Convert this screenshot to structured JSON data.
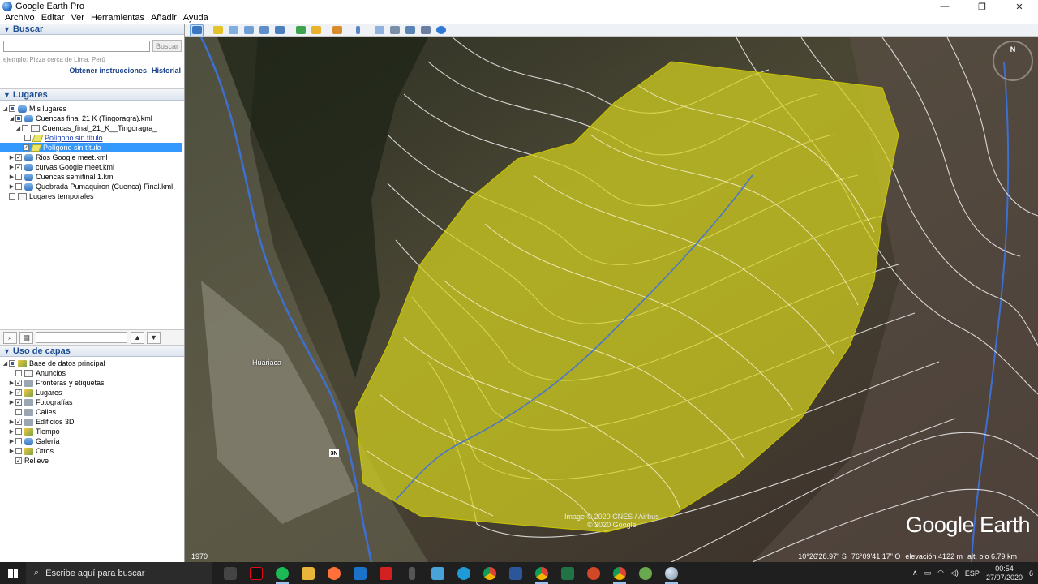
{
  "window": {
    "title": "Google Earth Pro",
    "controls": [
      "—",
      "❐",
      "✕"
    ]
  },
  "menu": [
    "Archivo",
    "Editar",
    "Ver",
    "Herramientas",
    "Añadir",
    "Ayuda"
  ],
  "search": {
    "header": "Buscar",
    "button": "Buscar",
    "hint": "ejemplo: Pizza cerca de Lima, Perú",
    "link_directions": "Obtener instrucciones",
    "link_history": "Historial"
  },
  "places": {
    "header": "Lugares",
    "items": [
      {
        "label": "Mis lugares"
      },
      {
        "label": "Cuencas final 21 K (Tingoragra).kml"
      },
      {
        "label": "Cuencas_final_21_K__Tingoragra_"
      },
      {
        "label": "Polígono sin título"
      },
      {
        "label": "Polígono sin título"
      },
      {
        "label": "Rios Google meet.kml"
      },
      {
        "label": "curvas Google meet.kml"
      },
      {
        "label": "Cuencas semifinal 1.kml"
      },
      {
        "label": "Quebrada Pumaquiron (Cuenca) Final.kml"
      },
      {
        "label": "Lugares temporales"
      }
    ]
  },
  "layers": {
    "header": "Uso de capas",
    "items": [
      {
        "label": "Base de datos principal"
      },
      {
        "label": "Anuncios"
      },
      {
        "label": "Fronteras y etiquetas"
      },
      {
        "label": "Lugares"
      },
      {
        "label": "Fotografías"
      },
      {
        "label": "Calles"
      },
      {
        "label": "Edificios 3D"
      },
      {
        "label": "Tiempo"
      },
      {
        "label": "Galería"
      },
      {
        "label": "Otros"
      },
      {
        "label": "Relieve"
      }
    ]
  },
  "map": {
    "credit_line1": "Image © 2020 CNES / Airbus",
    "credit_line2": "© 2020 Google",
    "logo": "Google Earth",
    "year": "1970",
    "lat": "10°26'28.97\" S",
    "lon": "76°09'41.17\" O",
    "elevation": "elevación  4122 m",
    "eye_alt": "alt. ojo  6.79 km",
    "town": "Huariaca",
    "road": "3N",
    "north": "N"
  },
  "taskbar": {
    "search_placeholder": "Escribe aquí para buscar",
    "lang": "ESP",
    "time": "00:54",
    "date": "27/07/2020",
    "notification_count": "6"
  }
}
